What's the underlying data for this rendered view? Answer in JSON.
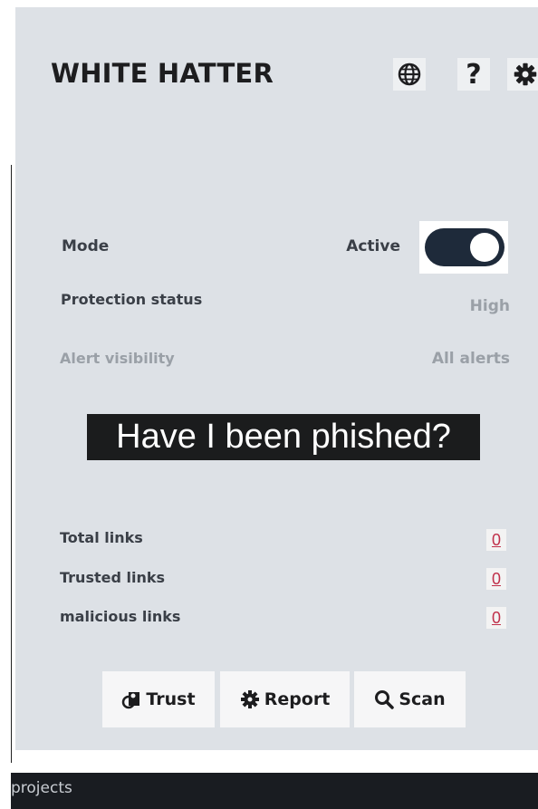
{
  "header": {
    "title": "WHITE HATTER",
    "help_label": "?"
  },
  "settings": {
    "mode_label": "Mode",
    "mode_state": "Active",
    "mode_on": true,
    "protection_label": "Protection status",
    "protection_value": "High",
    "alert_label": "Alert visibility",
    "alert_value": "All alerts"
  },
  "banner": {
    "text": "Have I been phished?"
  },
  "stats": {
    "total_label": "Total links",
    "total_value": "0",
    "trusted_label": "Trusted links",
    "trusted_value": "0",
    "malicious_label": "malicious links",
    "malicious_value": "0"
  },
  "actions": {
    "trust_label": "Trust",
    "report_label": "Report",
    "scan_label": "Scan"
  },
  "taskbar": {
    "text": "projects"
  },
  "colors": {
    "panel_bg": "#dde1e6",
    "toggle_on": "#1e2a3a",
    "link_red": "#c0304a",
    "banner_bg": "#1b1c1d"
  },
  "icons": [
    "globe-icon",
    "help-icon",
    "gear-icon",
    "user-shield-icon",
    "bug-icon",
    "search-icon"
  ]
}
